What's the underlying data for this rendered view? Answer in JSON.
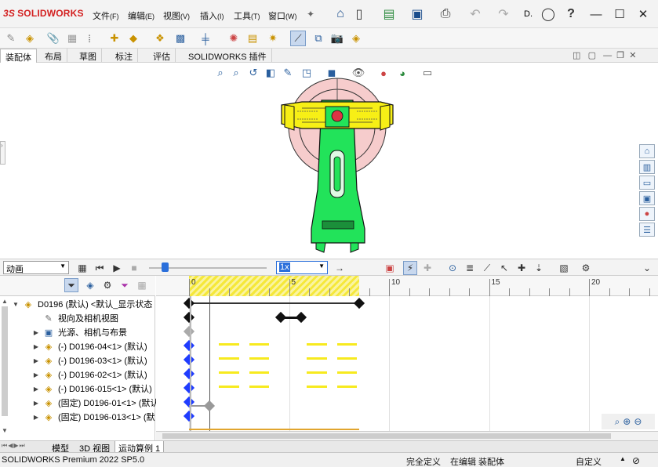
{
  "app": {
    "logo_text": "SOLIDWORKS",
    "logo_mark": "3S"
  },
  "menu": [
    {
      "label": "文件",
      "key": "(F)"
    },
    {
      "label": "编辑",
      "key": "(E)"
    },
    {
      "label": "视图",
      "key": "(V)"
    },
    {
      "label": "插入",
      "key": "(I)"
    },
    {
      "label": "工具",
      "key": "(T)"
    },
    {
      "label": "窗口",
      "key": "(W)"
    }
  ],
  "title_search_hint": "D.",
  "command_tabs": [
    "装配体",
    "布局",
    "草图",
    "标注",
    "评估",
    "SOLIDWORKS 插件"
  ],
  "motion": {
    "study_type": "动画",
    "speed": "1x"
  },
  "timeline": {
    "ticks": [
      {
        "label": "0",
        "sec": 0
      },
      {
        "label": "5",
        "sec": 5
      },
      {
        "label": "10",
        "sec": 10
      },
      {
        "label": "15",
        "sec": 15
      },
      {
        "label": "20",
        "sec": 20
      }
    ],
    "time_bar_sec": 1.0
  },
  "tree": {
    "root": "D0196 (默认) <默认_显示状态",
    "items": [
      {
        "label": "视向及相机视图",
        "icon": "camera-icon",
        "expandable": false
      },
      {
        "label": "光源、相机与布景",
        "icon": "lights-folder-icon",
        "expandable": true
      },
      {
        "label": "(-) D0196-04<1> (默认)",
        "icon": "part-icon",
        "expandable": true
      },
      {
        "label": "(-) D0196-03<1> (默认)",
        "icon": "part-icon",
        "expandable": true
      },
      {
        "label": "(-) D0196-02<1> (默认)",
        "icon": "part-icon",
        "expandable": true
      },
      {
        "label": "(-) D0196-015<1> (默认)",
        "icon": "part-icon",
        "expandable": true
      },
      {
        "label": "(固定) D0196-01<1> (默认",
        "icon": "part-icon",
        "expandable": true
      },
      {
        "label": "(固定) D0196-013<1> (默",
        "icon": "part-icon",
        "expandable": true
      }
    ]
  },
  "bottom_tabs": [
    "模型",
    "3D 视图",
    "运动算例 1"
  ],
  "status": {
    "product": "SOLIDWORKS Premium 2022 SP5.0",
    "definition": "完全定义",
    "editing": "在编辑 装配体",
    "units": "自定义"
  },
  "colors": {
    "accent": "#2a5f9e",
    "logo_red": "#d32020",
    "model_green": "#22e35a",
    "model_yellow": "#f7ef16",
    "key_blue": "#1f3cff",
    "timeline_yellow": "#f7ea1e"
  }
}
